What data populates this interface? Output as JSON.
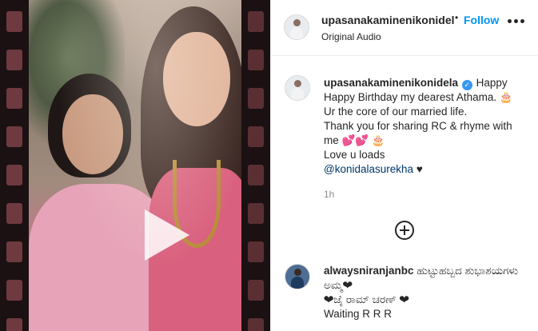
{
  "post": {
    "header": {
      "username": "upasanakaminenikonidela",
      "separator": "•",
      "follow_label": "Follow",
      "audio_label": "Original Audio",
      "more_icon": "more-options-icon"
    },
    "caption": {
      "username": "upasanakaminenikonidela",
      "verified_icon": "verified-badge-icon",
      "line1": "Happy",
      "line2": "Happy Birthday my dearest Athama. 🎂",
      "line3": "Ur the core of our married life.",
      "line4": "Thank you for sharing RC & rhyme with",
      "line5": "me 💕💕 🎂",
      "line6": "Love u loads",
      "mention": "@konidalasurekha",
      "heart": "♥",
      "time": "1h"
    },
    "load_more_icon": "plus-circle-icon",
    "comments": [
      {
        "username": "alwaysniranjanbc",
        "text1": "ಹುಟ್ಟುಹಬ್ಬದ ಶುಭಾಶಯಗಳು",
        "text2": "ಅಮ್ಮ❤",
        "text3": "❤ಜೈ ರಾಮ್ ಚರಣ್ ❤",
        "text4": "Waiting R R R"
      }
    ],
    "colors": {
      "accent": "#0095f6",
      "verified": "#3897f0",
      "mention": "#00376b",
      "muted": "#8e8e8e"
    }
  }
}
